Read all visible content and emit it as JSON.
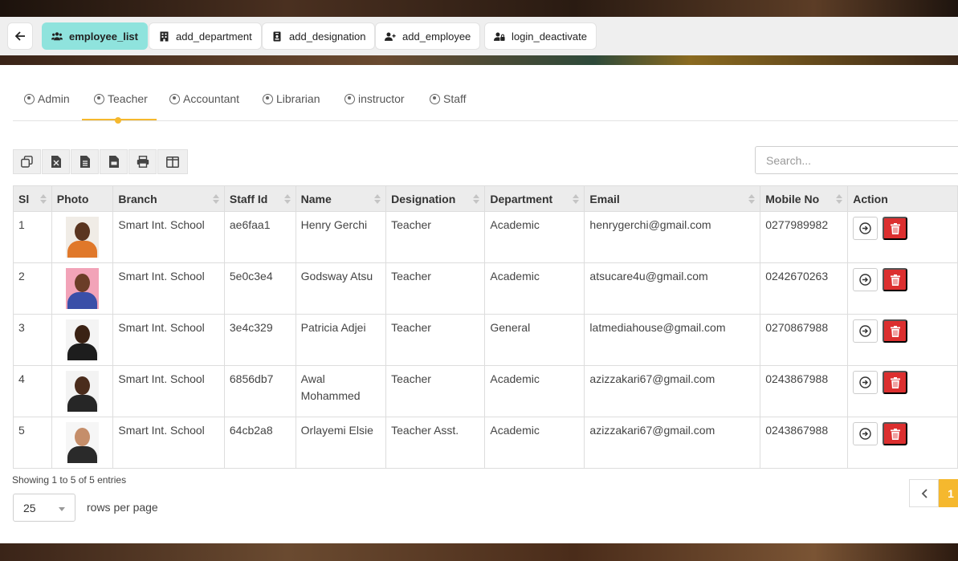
{
  "topbar": {
    "buttons": [
      {
        "label": "employee_list",
        "icon": "users-icon",
        "active": true
      },
      {
        "label": "add_department",
        "icon": "building-icon"
      },
      {
        "label": "add_designation",
        "icon": "badge-icon"
      },
      {
        "label": "add_employee",
        "icon": "user-plus-icon"
      },
      {
        "label": "login_deactivate",
        "icon": "user-lock-icon"
      }
    ]
  },
  "tabs": [
    {
      "label": "Admin"
    },
    {
      "label": "Teacher",
      "active": true
    },
    {
      "label": "Accountant"
    },
    {
      "label": "Librarian"
    },
    {
      "label": "instructor"
    },
    {
      "label": "Staff"
    }
  ],
  "search": {
    "placeholder": "Search..."
  },
  "table": {
    "columns": [
      "Sl",
      "Photo",
      "Branch",
      "Staff Id",
      "Name",
      "Designation",
      "Department",
      "Email",
      "Mobile No",
      "Action"
    ],
    "rows": [
      {
        "sl": "1",
        "branch": "Smart Int. School",
        "staff_id": "ae6faa1",
        "name": "Henry Gerchi",
        "designation": "Teacher",
        "department": "Academic",
        "email": "henrygerchi@gmail.com",
        "mobile": "0277989982"
      },
      {
        "sl": "2",
        "branch": "Smart Int. School",
        "staff_id": "5e0c3e4",
        "name": "Godsway Atsu",
        "designation": "Teacher",
        "department": "Academic",
        "email": "atsucare4u@gmail.com",
        "mobile": "0242670263"
      },
      {
        "sl": "3",
        "branch": "Smart Int. School",
        "staff_id": "3e4c329",
        "name": "Patricia Adjei",
        "designation": "Teacher",
        "department": "General",
        "email": "latmediahouse@gmail.com",
        "mobile": "0270867988"
      },
      {
        "sl": "4",
        "branch": "Smart Int. School",
        "staff_id": "6856db7",
        "name": "Awal Mohammed",
        "designation": "Teacher",
        "department": "Academic",
        "email": "azizzakari67@gmail.com",
        "mobile": "0243867988"
      },
      {
        "sl": "5",
        "branch": "Smart Int. School",
        "staff_id": "64cb2a8",
        "name": "Orlayemi Elsie",
        "designation": "Teacher Asst.",
        "department": "Academic",
        "email": "azizzakari67@gmail.com",
        "mobile": "0243867988"
      }
    ]
  },
  "footer": {
    "info": "Showing 1 to 5 of 5 entries",
    "per_page_value": "25",
    "per_page_label": "rows per page",
    "current_page": "1"
  },
  "colors": {
    "accent": "#f5b82e",
    "active_button": "#8fe3dd",
    "delete": "#dc2f2f"
  }
}
